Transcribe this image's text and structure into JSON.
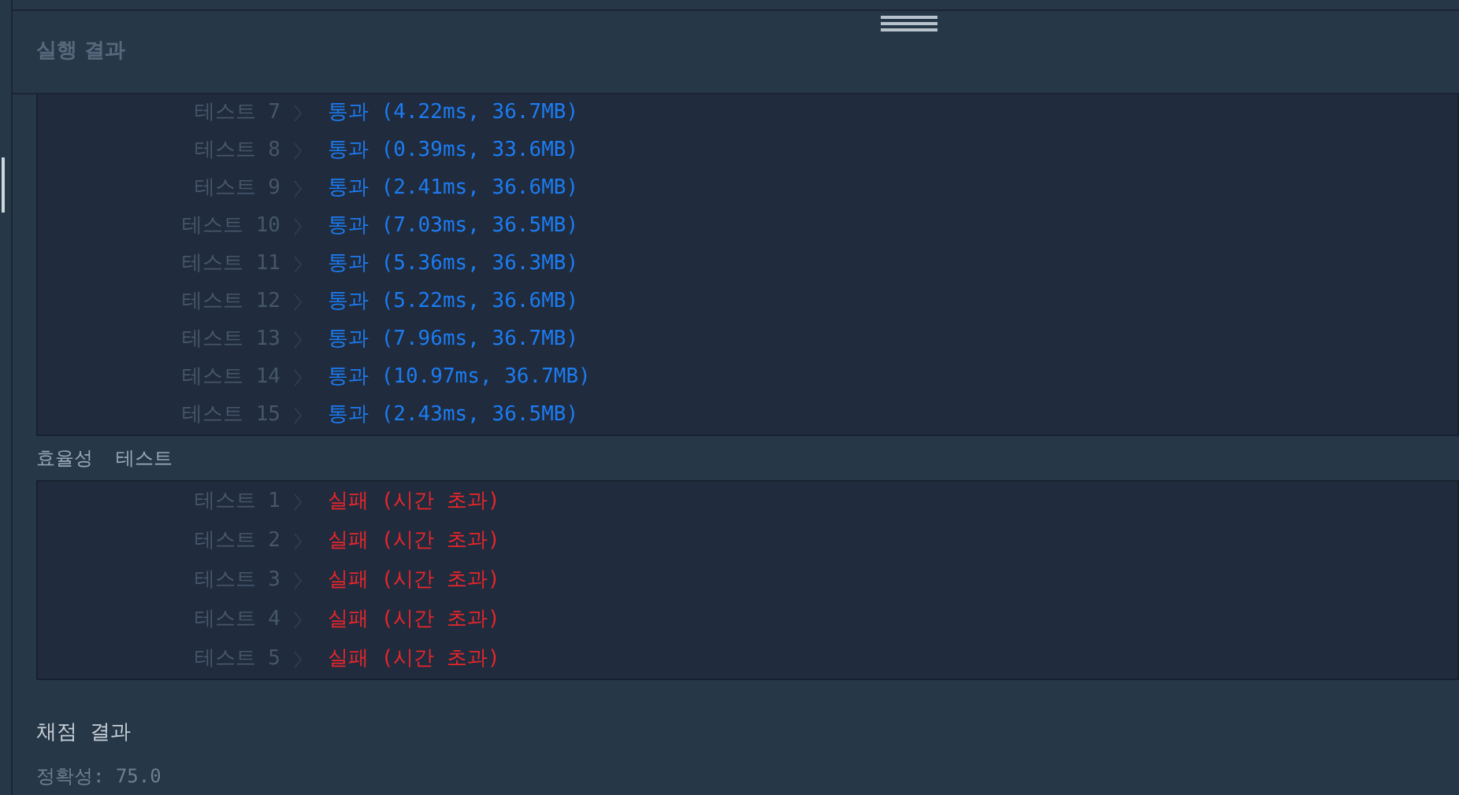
{
  "panel": {
    "title": "실행 결과"
  },
  "sections": [
    {
      "rows": [
        {
          "label": "테스트 7",
          "result": "통과 (4.22ms, 36.7MB)",
          "kind": "pass"
        },
        {
          "label": "테스트 8",
          "result": "통과 (0.39ms, 33.6MB)",
          "kind": "pass"
        },
        {
          "label": "테스트 9",
          "result": "통과 (2.41ms, 36.6MB)",
          "kind": "pass"
        },
        {
          "label": "테스트 10",
          "result": "통과 (7.03ms, 36.5MB)",
          "kind": "pass"
        },
        {
          "label": "테스트 11",
          "result": "통과 (5.36ms, 36.3MB)",
          "kind": "pass"
        },
        {
          "label": "테스트 12",
          "result": "통과 (5.22ms, 36.6MB)",
          "kind": "pass"
        },
        {
          "label": "테스트 13",
          "result": "통과 (7.96ms, 36.7MB)",
          "kind": "pass"
        },
        {
          "label": "테스트 14",
          "result": "통과 (10.97ms, 36.7MB)",
          "kind": "pass"
        },
        {
          "label": "테스트 15",
          "result": "통과 (2.43ms, 36.5MB)",
          "kind": "pass"
        }
      ]
    },
    {
      "heading": "효율성  테스트",
      "rows": [
        {
          "label": "테스트 1",
          "result": "실패 (시간 초과)",
          "kind": "fail"
        },
        {
          "label": "테스트 2",
          "result": "실패 (시간 초과)",
          "kind": "fail"
        },
        {
          "label": "테스트 3",
          "result": "실패 (시간 초과)",
          "kind": "fail"
        },
        {
          "label": "테스트 4",
          "result": "실패 (시간 초과)",
          "kind": "fail"
        },
        {
          "label": "테스트 5",
          "result": "실패 (시간 초과)",
          "kind": "fail"
        }
      ]
    }
  ],
  "grading": {
    "title": "채점 결과",
    "accuracy": "정확성: 75.0"
  }
}
